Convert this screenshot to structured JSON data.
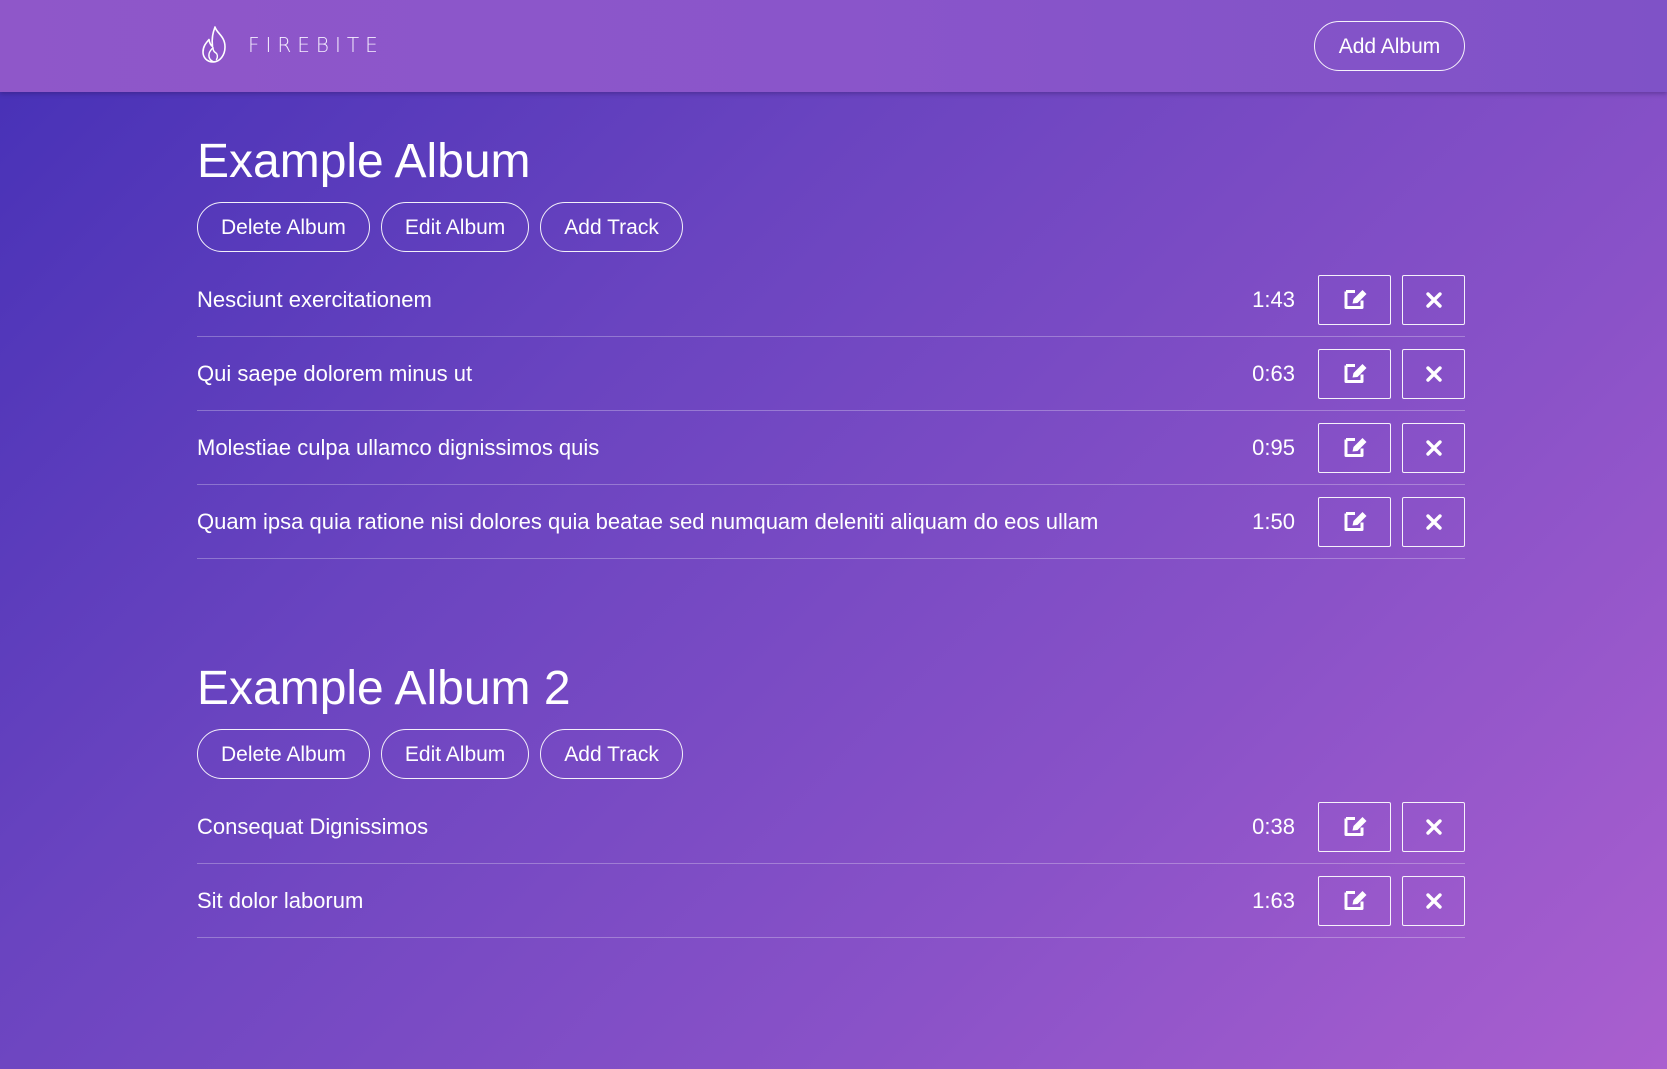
{
  "header": {
    "brand_name": "FIREBITE",
    "brand_icon": "flame-icon",
    "add_album_label": "Add Album"
  },
  "theme": {
    "gradient_start": "#4530b6",
    "gradient_end": "#aa5fcf",
    "header_color": "#8a55ca",
    "text_color": "#ffffff"
  },
  "albums": [
    {
      "title": "Example Album",
      "actions": {
        "delete_label": "Delete Album",
        "edit_label": "Edit Album",
        "add_track_label": "Add Track"
      },
      "tracks": [
        {
          "title": "Nesciunt exercitationem",
          "duration": "1:43"
        },
        {
          "title": "Qui saepe dolorem minus ut",
          "duration": "0:63"
        },
        {
          "title": "Molestiae culpa ullamco dignissimos quis",
          "duration": "0:95"
        },
        {
          "title": "Quam ipsa quia ratione nisi dolores quia beatae sed numquam deleniti aliquam do eos ullam",
          "duration": "1:50"
        }
      ]
    },
    {
      "title": "Example Album 2",
      "actions": {
        "delete_label": "Delete Album",
        "edit_label": "Edit Album",
        "add_track_label": "Add Track"
      },
      "tracks": [
        {
          "title": "Consequat Dignissimos",
          "duration": "0:38"
        },
        {
          "title": "Sit dolor laborum",
          "duration": "1:63"
        }
      ]
    }
  ],
  "track_icons": {
    "edit": "edit-icon",
    "delete": "close-icon"
  }
}
